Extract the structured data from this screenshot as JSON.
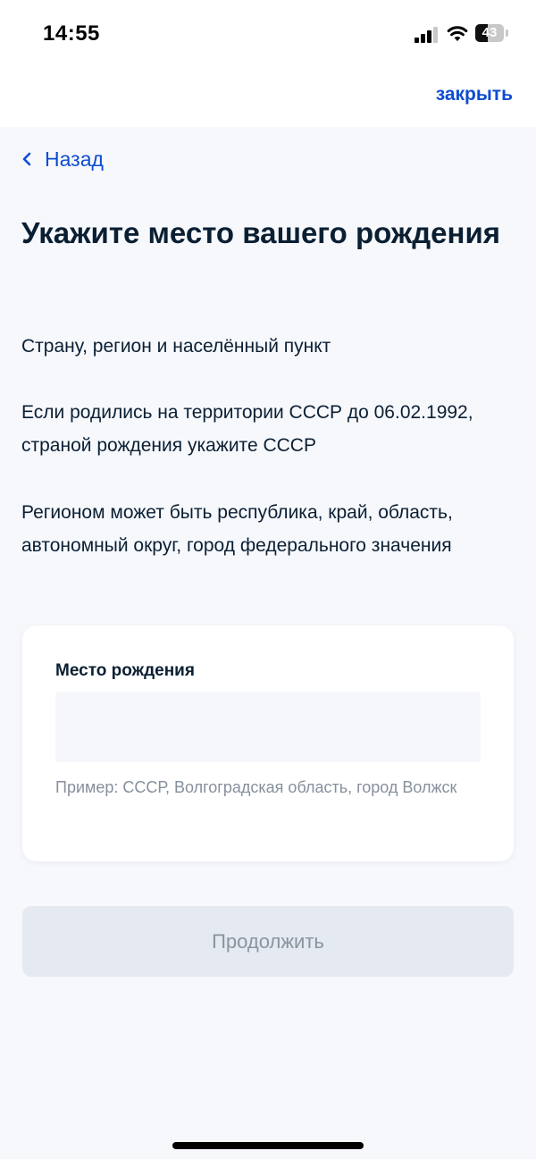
{
  "status_bar": {
    "time": "14:55",
    "battery_level": "43",
    "battery_fraction": 0.43,
    "signal_bars_active": 3,
    "signal_bars_total": 4,
    "icons": [
      "signal-icon",
      "wifi-icon",
      "battery-icon"
    ]
  },
  "header": {
    "close_label": "закрыть"
  },
  "nav": {
    "back_label": "Назад",
    "back_icon": "chevron-left-icon"
  },
  "page": {
    "title": "Укажите место вашего рождения",
    "paragraphs": [
      "Страну, регион и населённый пункт",
      "Если родились на территории СССР до 06.02.1992, страной рождения укажите СССР",
      "Регионом может быть республика, край, область, автономный округ, город федерального значения"
    ]
  },
  "form": {
    "birthplace_label": "Место рождения",
    "birthplace_value": "",
    "birthplace_hint": "Пример: СССР, Волгоградская область, город Волжск"
  },
  "actions": {
    "continue_label": "Продолжить",
    "continue_disabled": true
  },
  "colors": {
    "accent": "#0d4cd3",
    "background": "#f6f8fc",
    "text": "#0b1f33",
    "hint": "#86909c",
    "disabled_button": "#e4e9f2"
  }
}
